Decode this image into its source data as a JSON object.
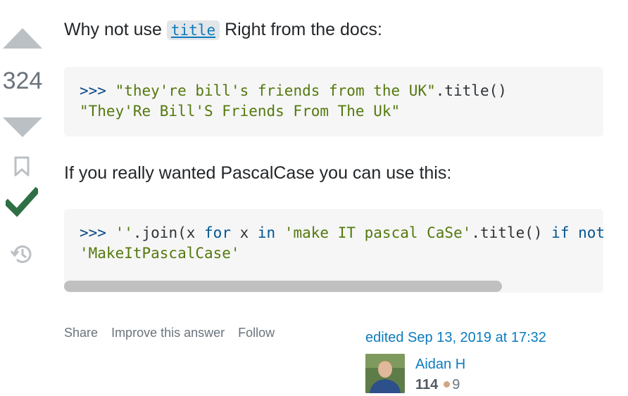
{
  "vote": {
    "count": "324"
  },
  "answer": {
    "para1": {
      "before": "Why not use ",
      "code": "title",
      "after": " Right from the docs:"
    },
    "code1": {
      "prompt": ">>> ",
      "line1_str": "\"they're bill's friends from the UK\"",
      "line1_rest": ".title()",
      "line2": "\"They'Re Bill'S Friends From The Uk\""
    },
    "para2": "If you really wanted PascalCase you can use this:",
    "code2": {
      "prompt": ">>> ",
      "seg_a": "''",
      "seg_b": ".join(x ",
      "kw_for": "for",
      "seg_c": " x ",
      "kw_in": "in",
      "seg_d": " ",
      "seg_e": "'make IT pascal CaSe'",
      "seg_f": ".title() ",
      "kw_if": "if",
      "seg_g": " ",
      "kw_not": "not",
      "line2": "'MakeItPascalCase'"
    }
  },
  "actions": {
    "share": "Share",
    "improve": "Improve this answer",
    "follow": "Follow"
  },
  "edited": {
    "text": "edited Sep 13, 2019 at 17:32"
  },
  "user": {
    "name": "Aidan H",
    "reputation": "114",
    "bronze": "9"
  },
  "colors": {
    "accepted_check": "#2f6f44",
    "link": "#0c7bbd",
    "vote_arrow": "#bbc0c4"
  }
}
